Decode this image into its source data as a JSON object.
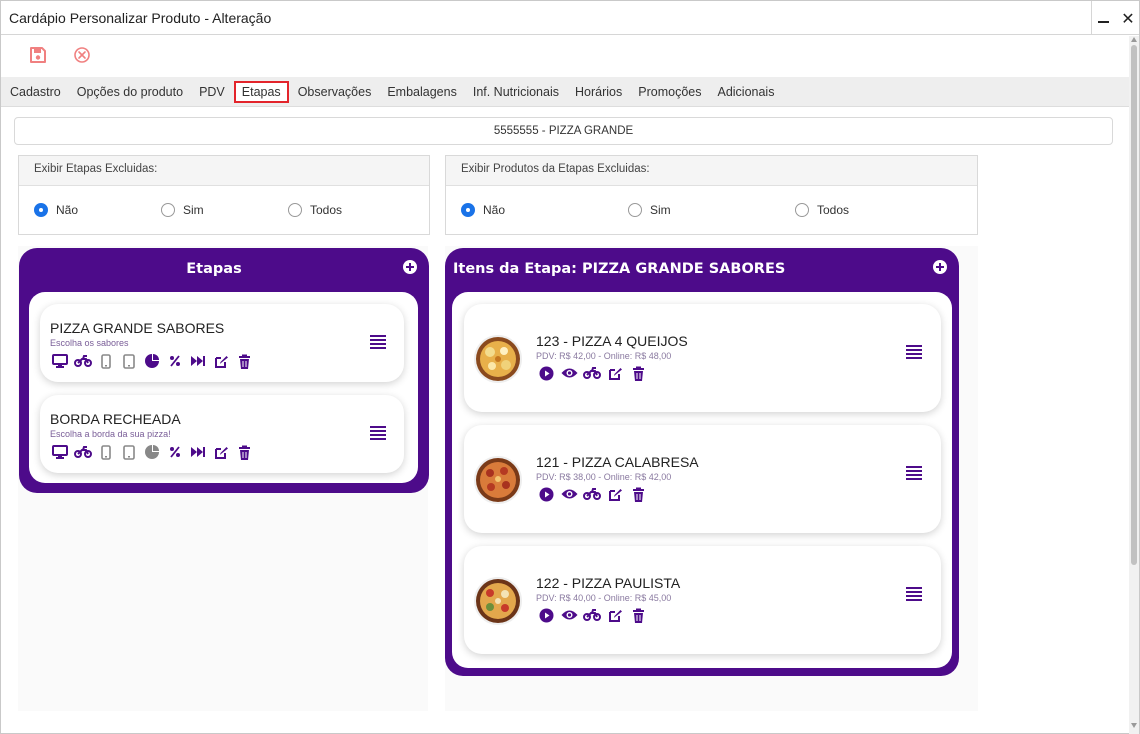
{
  "window": {
    "title": "Cardápio Personalizar Produto - Alteração",
    "minimize_icon": "minimize-icon",
    "close_label": "✕"
  },
  "toolbar": {
    "save_icon": "save-icon",
    "cancel_icon": "cancel-icon",
    "accent": "#f08080"
  },
  "tabs": [
    {
      "label": "Cadastro"
    },
    {
      "label": "Opções do produto"
    },
    {
      "label": "PDV"
    },
    {
      "label": "Etapas",
      "active": true
    },
    {
      "label": "Observações"
    },
    {
      "label": "Embalagens"
    },
    {
      "label": "Inf. Nutricionais"
    },
    {
      "label": "Horários"
    },
    {
      "label": "Promoções"
    },
    {
      "label": "Adicionais"
    }
  ],
  "product": {
    "header": "5555555 - PIZZA GRANDE"
  },
  "filters": {
    "etapas": {
      "label": "Exibir Etapas Excluidas:",
      "options": [
        "Não",
        "Sim",
        "Todos"
      ],
      "selected": "Não"
    },
    "produtos": {
      "label": "Exibir Produtos da Etapas Excluidas:",
      "options": [
        "Não",
        "Sim",
        "Todos"
      ],
      "selected": "Não"
    }
  },
  "colors": {
    "panel": "#4d0b8a",
    "radio_selected": "#1a73e8",
    "active_tab_border": "#e3242b"
  },
  "etapas_panel": {
    "title": "Etapas",
    "items": [
      {
        "name": "PIZZA GRANDE SABORES",
        "description": "Escolha os sabores"
      },
      {
        "name": "BORDA RECHEADA",
        "description": "Escolha a borda da sua pizza!"
      }
    ],
    "item_icons": [
      "monitor-icon",
      "motorcycle-icon",
      "mobile-icon",
      "tablet-icon",
      "pie-chart-icon",
      "percent-icon",
      "fast-forward-icon",
      "edit-icon",
      "trash-icon",
      "menu-icon"
    ]
  },
  "itens_panel": {
    "title": "Itens da Etapa: PIZZA GRANDE SABORES",
    "items": [
      {
        "name": "123 - PIZZA 4 QUEIJOS",
        "prices": "PDV: R$ 42,00 - Online: R$ 48,00"
      },
      {
        "name": "121 - PIZZA CALABRESA",
        "prices": "PDV: R$ 38,00 - Online: R$ 42,00"
      },
      {
        "name": "122 - PIZZA PAULISTA",
        "prices": "PDV: R$ 40,00 - Online: R$ 45,00"
      }
    ],
    "item_icons": [
      "play-icon",
      "eye-icon",
      "motorcycle-icon",
      "edit-icon",
      "trash-icon",
      "menu-icon"
    ]
  }
}
